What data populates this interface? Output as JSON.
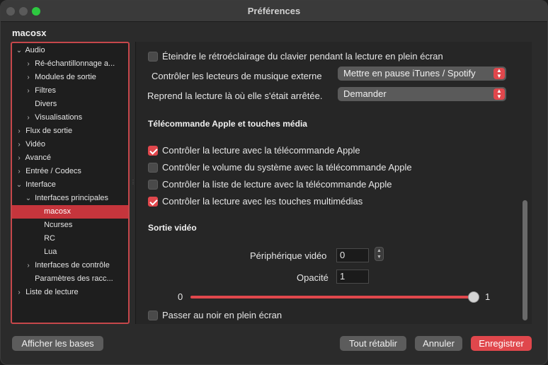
{
  "window": {
    "title": "Préférences"
  },
  "section": {
    "title": "macosx"
  },
  "sidebar": {
    "items": [
      {
        "label": "Audio",
        "chevron": "⌄"
      },
      {
        "label": "Ré-échantillonnage a...",
        "chevron": "›"
      },
      {
        "label": "Modules de sortie",
        "chevron": "›"
      },
      {
        "label": "Filtres",
        "chevron": "›"
      },
      {
        "label": "Divers",
        "chevron": ""
      },
      {
        "label": "Visualisations",
        "chevron": "›"
      },
      {
        "label": "Flux de sortie",
        "chevron": "›"
      },
      {
        "label": "Vidéo",
        "chevron": "›"
      },
      {
        "label": "Avancé",
        "chevron": "›"
      },
      {
        "label": "Entrée / Codecs",
        "chevron": "›"
      },
      {
        "label": "Interface",
        "chevron": "⌄"
      },
      {
        "label": "Interfaces principales",
        "chevron": "⌄"
      },
      {
        "label": "macosx",
        "chevron": ""
      },
      {
        "label": "Ncurses",
        "chevron": ""
      },
      {
        "label": "RC",
        "chevron": ""
      },
      {
        "label": "Lua",
        "chevron": ""
      },
      {
        "label": "Interfaces de contrôle",
        "chevron": "›"
      },
      {
        "label": "Paramètres des racc...",
        "chevron": ""
      },
      {
        "label": "Liste de lecture",
        "chevron": "›"
      }
    ]
  },
  "settings": {
    "backlight_label": "Éteindre le rétroéclairage du clavier pendant la lecture en plein écran",
    "music_control_label": "Contrôler les lecteurs de musique externe",
    "music_control_value": "Mettre en pause iTunes / Spotify",
    "resume_label": "Reprend la lecture là où elle s'était arrêtée.",
    "resume_value": "Demander",
    "remote_heading": "Télécommande Apple et touches média",
    "remote_items": [
      {
        "label": "Contrôler la lecture avec la télécommande Apple",
        "checked": true
      },
      {
        "label": "Contrôler le volume du système avec la télécommande Apple",
        "checked": false
      },
      {
        "label": "Contrôler la liste de lecture avec la télécommande Apple",
        "checked": false
      },
      {
        "label": "Contrôler la lecture avec les touches multimédias",
        "checked": true
      }
    ],
    "video_heading": "Sortie vidéo",
    "device_label": "Périphérique vidéo",
    "device_value": "0",
    "opacity_label": "Opacité",
    "opacity_value": "1",
    "slider_min": "0",
    "slider_max": "1",
    "slider_value": 1,
    "blackout_label": "Passer au noir en plein écran"
  },
  "footer": {
    "show_basic": "Afficher les bases",
    "reset_all": "Tout rétablir",
    "cancel": "Annuler",
    "save": "Enregistrer"
  },
  "colors": {
    "accent": "#e0474c",
    "selection": "#c6353c",
    "border_highlight": "#c6474b"
  }
}
